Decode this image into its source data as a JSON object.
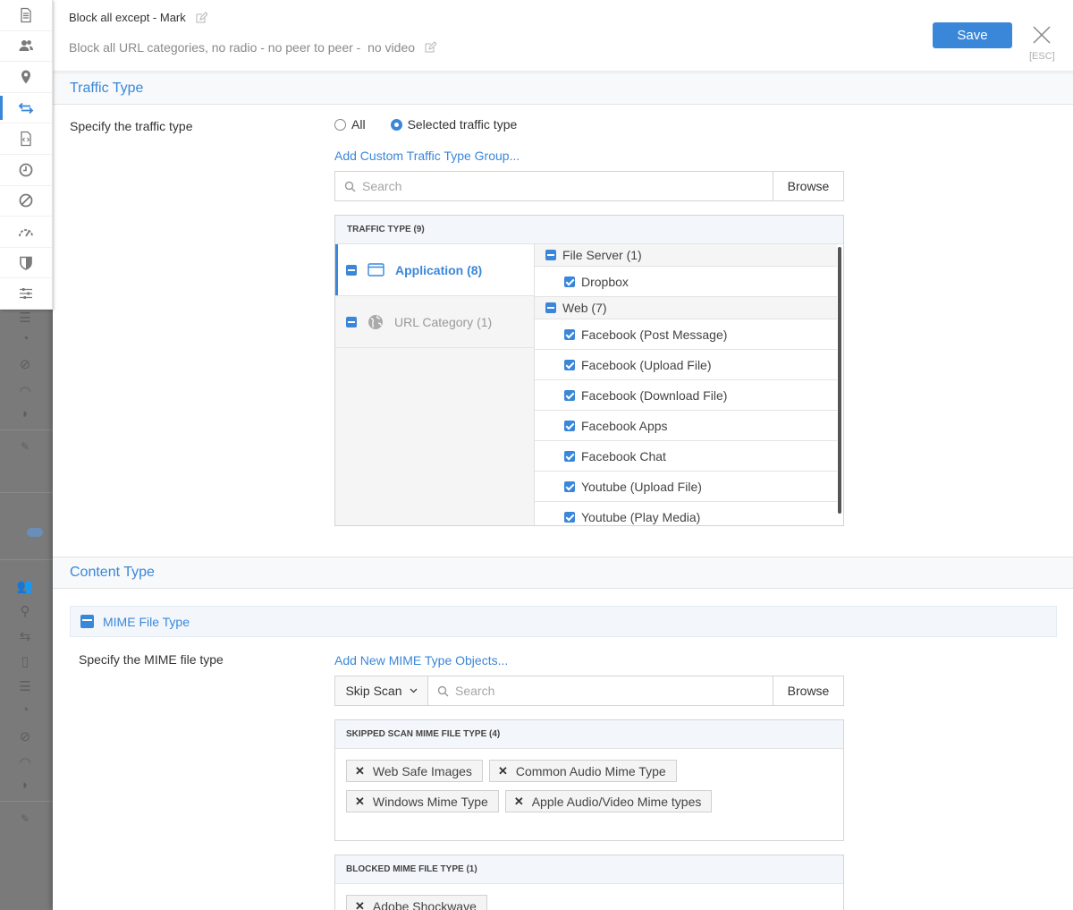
{
  "header": {
    "title": "Block all except - Mark",
    "description": "Block all URL categories, no radio - no peer to peer -  no video",
    "save_label": "Save",
    "esc_label": "[ESC]"
  },
  "sidenav": {
    "items": [
      {
        "icon": "document-icon"
      },
      {
        "icon": "users-icon"
      },
      {
        "icon": "location-pin-icon"
      },
      {
        "icon": "traffic-arrows-icon"
      },
      {
        "icon": "code-file-icon"
      },
      {
        "icon": "clock-icon"
      },
      {
        "icon": "block-icon"
      },
      {
        "icon": "speedometer-icon"
      },
      {
        "icon": "shield-icon"
      },
      {
        "icon": "sliders-icon"
      }
    ]
  },
  "traffic_type": {
    "section_title": "Traffic Type",
    "label": "Specify the traffic type",
    "radio_all": "All",
    "radio_selected": "Selected traffic type",
    "add_link": "Add Custom Traffic Type Group...",
    "search_placeholder": "Search",
    "browse_label": "Browse",
    "list_header": "TRAFFIC TYPE (9)",
    "categories": [
      {
        "label": "Application (8)"
      },
      {
        "label": "URL Category (1)"
      }
    ],
    "groups": [
      {
        "label": "File Server (1)",
        "items": [
          "Dropbox"
        ]
      },
      {
        "label": "Web (7)",
        "items": [
          "Facebook (Post Message)",
          "Facebook (Upload File)",
          "Facebook (Download File)",
          "Facebook Apps",
          "Facebook Chat",
          "Youtube (Upload File)",
          "Youtube (Play Media)"
        ]
      }
    ]
  },
  "content_type": {
    "section_title": "Content Type",
    "mime_bar": "MIME File Type",
    "label": "Specify the MIME file type",
    "add_link": "Add New MIME Type Objects...",
    "skip_label": "Skip Scan",
    "search_placeholder": "Search",
    "browse_label": "Browse",
    "skipped_header": "SKIPPED SCAN MIME FILE TYPE (4)",
    "skipped": [
      "Web Safe Images",
      "Common Audio Mime Type",
      "Windows Mime Type",
      "Apple Audio/Video Mime types"
    ],
    "blocked_header": "BLOCKED MIME FILE TYPE (1)",
    "blocked": [
      "Adobe Shockwave"
    ]
  }
}
